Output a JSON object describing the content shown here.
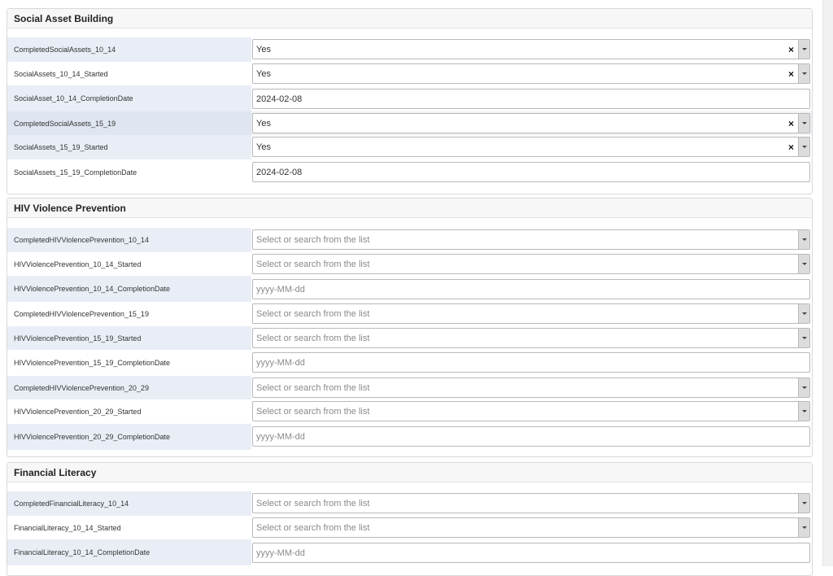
{
  "sections": [
    {
      "title": "Social Asset Building",
      "rows": [
        {
          "label": "CompletedSocialAssets_10_14",
          "type": "select",
          "value": "Yes"
        },
        {
          "label": "SocialAssets_10_14_Started",
          "type": "select",
          "value": "Yes"
        },
        {
          "label": "SocialAsset_10_14_CompletionDate",
          "type": "date",
          "value": "2024-02-08"
        },
        {
          "label": "CompletedSocialAssets_15_19",
          "type": "select",
          "value": "Yes"
        },
        {
          "label": "SocialAssets_15_19_Started",
          "type": "select",
          "value": "Yes"
        },
        {
          "label": "SocialAssets_15_19_CompletionDate",
          "type": "date",
          "value": "2024-02-08"
        }
      ]
    },
    {
      "title": "HIV Violence Prevention",
      "rows": [
        {
          "label": "CompletedHIVViolencePrevention_10_14",
          "type": "select",
          "placeholder": "Select or search from the list"
        },
        {
          "label": "HIVViolencePrevention_10_14_Started",
          "type": "select",
          "placeholder": "Select or search from the list"
        },
        {
          "label": "HIVViolencePrevention_10_14_CompletionDate",
          "type": "date",
          "placeholder": "yyyy-MM-dd"
        },
        {
          "label": "CompletedHIVViolencePrevention_15_19",
          "type": "select",
          "placeholder": "Select or search from the list"
        },
        {
          "label": "HIVViolencePrevention_15_19_Started",
          "type": "select",
          "placeholder": "Select or search from the list"
        },
        {
          "label": "HIVViolencePrevention_15_19_CompletionDate",
          "type": "date",
          "placeholder": "yyyy-MM-dd"
        },
        {
          "label": "CompletedHIVViolencePrevention_20_29",
          "type": "select",
          "placeholder": "Select or search from the list"
        },
        {
          "label": "HIVViolencePrevention_20_29_Started",
          "type": "select",
          "placeholder": "Select or search from the list"
        },
        {
          "label": "HIVViolencePrevention_20_29_CompletionDate",
          "type": "date",
          "placeholder": "yyyy-MM-dd"
        }
      ]
    },
    {
      "title": "Financial Literacy",
      "rows": [
        {
          "label": "CompletedFinancialLiteracy_10_14",
          "type": "select",
          "placeholder": "Select or search from the list"
        },
        {
          "label": "FinancialLiteracy_10_14_Started",
          "type": "select",
          "placeholder": "Select or search from the list"
        },
        {
          "label": "FinancialLiteracy_10_14_CompletionDate",
          "type": "date",
          "placeholder": "yyyy-MM-dd"
        }
      ]
    }
  ]
}
